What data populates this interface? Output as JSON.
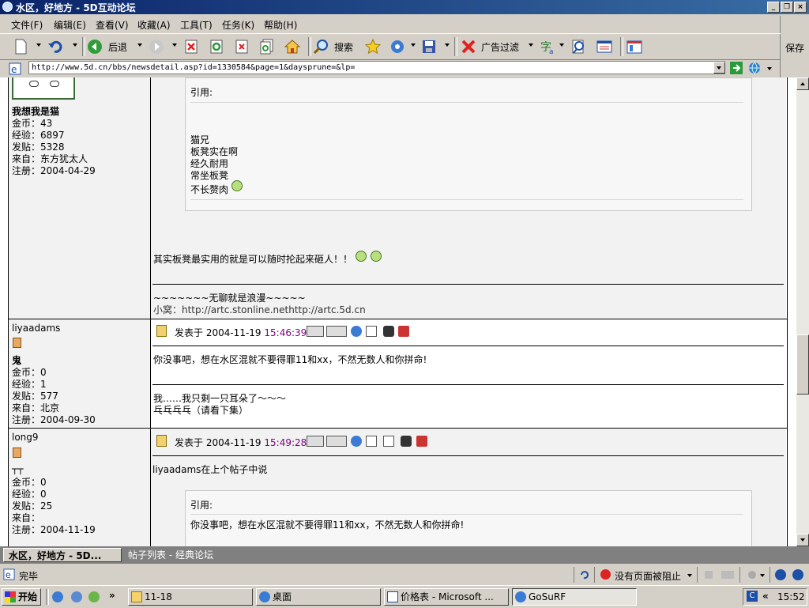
{
  "window": {
    "title": "水区，好地方 - 5D互动论坛"
  },
  "menu": [
    "文件(F)",
    "编辑(E)",
    "查看(V)",
    "收藏(A)",
    "工具(T)",
    "任务(K)",
    "帮助(H)"
  ],
  "save_label": "保存",
  "toolbar": {
    "back": "后退",
    "search": "搜索",
    "adfilter": "广告过滤"
  },
  "address": {
    "url": "http://www.5d.cn/bbs/newsdetail.asp?id=1330584&page=1&daysprune=&lp="
  },
  "posts": [
    {
      "user": {
        "nickname": "我想我是猫",
        "coins": "金币：43",
        "exp": "经验：6897",
        "posts": "发贴：5328",
        "from": "来自：东方犹太人",
        "reg": "注册：2004-04-29"
      },
      "quote": {
        "label": "引用:",
        "lines": [
          "猫兄",
          "板凳实在啊",
          "经久耐用",
          "常坐板凳",
          "不长赘肉"
        ]
      },
      "body": "其实板凳最实用的就是可以随时抡起来砸人！！",
      "signature": [
        "~~~~~~~无聊就是浪漫~~~~~",
        "小窝：http://artc.stonline.nethttp://artc.5d.cn"
      ]
    },
    {
      "user": {
        "name": "liyaadams",
        "nickname": "鬼",
        "coins": "金币：0",
        "exp": "经验：1",
        "posts": "发贴：577",
        "from": "来自：北京",
        "reg": "注册：2004-09-30"
      },
      "posted_prefix": "发表于 2004-11-19",
      "posted_time": "15:46:39",
      "body": "你没事吧，想在水区混就不要得罪11和xx，不然无数人和你拼命!",
      "signature": [
        "我……我只剩一只耳朵了～～～",
        "乓乓乓乓（请看下集）"
      ]
    },
    {
      "user": {
        "name": "long9",
        "nickname": "┬┬",
        "coins": "金币：0",
        "exp": "经验：0",
        "posts": "发贴：25",
        "from": "来自：",
        "reg": "注册：2004-11-19"
      },
      "posted_prefix": "发表于 2004-11-19",
      "posted_time": "15:49:28",
      "intro": "liyaadams在上个帖子中说",
      "quote": {
        "label": "引用:",
        "lines": [
          "你没事吧，想在水区混就不要得罪11和xx，不然无数人和你拼命!"
        ]
      }
    }
  ],
  "tabs": [
    "水区，好地方 - 5D...",
    "帖子列表 - 经典论坛"
  ],
  "status": {
    "done": "完毕",
    "popup": "没有页面被阻止"
  },
  "taskbar": {
    "start": "开始",
    "tasks": [
      "11-18",
      "桌面",
      "价格表 - Microsoft ...",
      "GoSuRF"
    ],
    "clock": "15:52"
  },
  "colors": {
    "title_start": "#0a246a",
    "title_end": "#3a6ea5",
    "cell_bg": "#f2f2f2",
    "time": "#800080"
  }
}
